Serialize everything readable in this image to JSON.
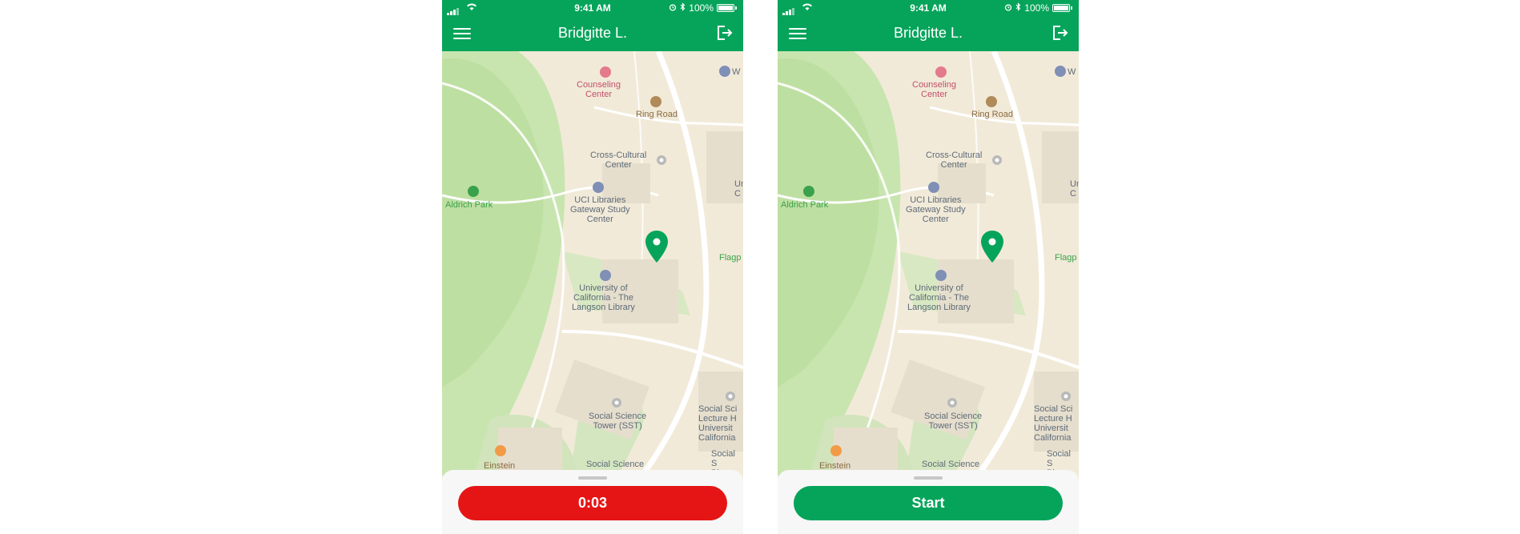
{
  "status_bar": {
    "time": "9:41 AM",
    "battery": "100%"
  },
  "screens": [
    {
      "header": {
        "title": "Bridgitte L."
      },
      "map_labels": {
        "counseling": "Counseling\nCenter",
        "ring_road": "Ring Road",
        "cross_cultural": "Cross-Cultural\nCenter",
        "gateway": "UCI Libraries\nGateway Study\nCenter",
        "aldrich": "Aldrich Park",
        "flagpole": "Flagp",
        "langson": "University of\nCalifornia - The\nLangson Library",
        "sst": "Social Science\nTower (SST)",
        "social_lecture": "Social Sci\nLecture H\nUniversit\nCalifornia",
        "social_pla": "Social S\nPla",
        "social_bottom": "Social Science",
        "einstein": "Einstein",
        "edge_w": "W",
        "edge_un": "Un\nC"
      },
      "action_button": {
        "label": "0:03",
        "state": "timer",
        "color": "#e51516"
      }
    },
    {
      "header": {
        "title": "Bridgitte L."
      },
      "map_labels": {
        "counseling": "Counseling\nCenter",
        "ring_road": "Ring Road",
        "cross_cultural": "Cross-Cultural\nCenter",
        "gateway": "UCI Libraries\nGateway Study\nCenter",
        "aldrich": "Aldrich Park",
        "flagpole": "Flagp",
        "langson": "University of\nCalifornia - The\nLangson Library",
        "sst": "Social Science\nTower (SST)",
        "social_lecture": "Social Sci\nLecture H\nUniversit\nCalifornia",
        "social_pla": "Social S\nPla",
        "social_bottom": "Social Science",
        "einstein": "Einstein",
        "edge_w": "W",
        "edge_un": "Un\nC"
      },
      "action_button": {
        "label": "Start",
        "state": "idle",
        "color": "#06a45b"
      }
    }
  ],
  "colors": {
    "brand_green": "#06a45b",
    "timer_red": "#e51516",
    "park_green": "#c8e5b0",
    "map_bg": "#f2ead9"
  },
  "icons": [
    "hamburger-menu-icon",
    "logout-icon",
    "location-pin-icon",
    "wifi-icon",
    "alarm-icon",
    "bluetooth-icon",
    "battery-icon"
  ]
}
